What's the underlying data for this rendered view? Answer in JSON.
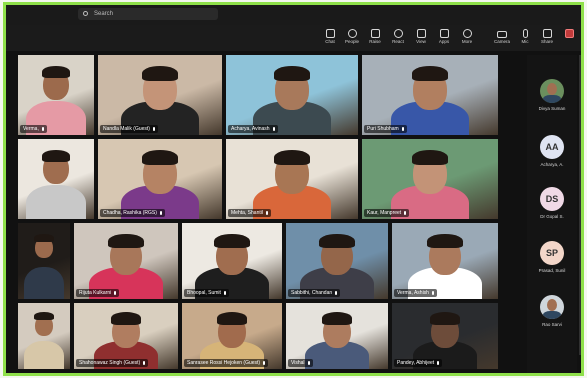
{
  "topbar": {
    "search_placeholder": "Search"
  },
  "toolbar": {
    "items": [
      {
        "label": "Chat",
        "icon": "chat-icon"
      },
      {
        "label": "People",
        "icon": "people-icon"
      },
      {
        "label": "Raise",
        "icon": "raise-hand-icon"
      },
      {
        "label": "React",
        "icon": "react-icon"
      },
      {
        "label": "View",
        "icon": "view-icon"
      },
      {
        "label": "Apps",
        "icon": "apps-icon"
      },
      {
        "label": "More",
        "icon": "more-icon"
      },
      {
        "label": "Camera",
        "icon": "camera-icon"
      },
      {
        "label": "Mic",
        "icon": "mic-icon"
      },
      {
        "label": "Share",
        "icon": "share-icon"
      },
      {
        "label": "",
        "icon": "leave-icon"
      }
    ]
  },
  "grid": {
    "tiles": [
      {
        "name": "Verma,",
        "bg": "#d9d3c8",
        "skin": "#9c6a4c",
        "shirt": "#e59aa5"
      },
      {
        "name": "Nandla Malik (Guest)",
        "bg": "#cbb9a6",
        "skin": "#c49478",
        "shirt": "#232323"
      },
      {
        "name": "Acharya, Avinash",
        "bg": "#8ec3d9",
        "skin": "#a8795b",
        "shirt": "#3c4a50"
      },
      {
        "name": "Puri Shubham",
        "bg": "#a7b0b8",
        "skin": "#b17f60",
        "shirt": "#3857a8"
      },
      {
        "name": "",
        "bg": "#ece7df",
        "skin": "#9f6d4f",
        "shirt": "#c8c8c8"
      },
      {
        "name": "Chadha, Rashika (RGS)",
        "bg": "#d7c7b2",
        "skin": "#b58364",
        "shirt": "#7b3a8a"
      },
      {
        "name": "Mehta, Shantil",
        "bg": "#e8e1d6",
        "skin": "#a87654",
        "shirt": "#d9673a"
      },
      {
        "name": "Kaur, Manpreet",
        "bg": "#6c9a74",
        "skin": "#c39377",
        "shirt": "#d96b84"
      },
      {
        "name": "",
        "bg": "#201c19",
        "skin": "#9b6a4d",
        "shirt": "#2f3a4a"
      },
      {
        "name": "Rijuta Kulkarni",
        "bg": "#cfc6bd",
        "skin": "#a8775a",
        "shirt": "#d7345a"
      },
      {
        "name": "Bhoopal, Sumit",
        "bg": "#ede9e2",
        "skin": "#a06d4f",
        "shirt": "#1e1e1e"
      },
      {
        "name": "Sabbithi, Chandan",
        "bg": "#6f8fa9",
        "skin": "#94664a",
        "shirt": "#3e3e48"
      },
      {
        "name": "Verma, Ashish",
        "bg": "#9aa9b6",
        "skin": "#ab7a5d",
        "shirt": "#ffffff"
      },
      {
        "name": "",
        "bg": "#d4cbbf",
        "skin": "#a16f50",
        "shirt": "#d7c7a8"
      },
      {
        "name": "Shahonawaz Singh (Guest)",
        "bg": "#d9cfbf",
        "skin": "#b07d60",
        "shirt": "#8f2f2f"
      },
      {
        "name": "Sanrasee Rossi Hejoken (Guest)",
        "bg": "#c7aa8b",
        "skin": "#a16b4d",
        "shirt": "#d6b478"
      },
      {
        "name": "Vishal",
        "bg": "#e5e2dc",
        "skin": "#ad7c5f",
        "shirt": "#4a5a7a"
      },
      {
        "name": "Pandey, Abhijeet",
        "bg": "#2a2c2f",
        "skin": "#6d4c3a",
        "shirt": "#1b1b1b"
      }
    ]
  },
  "panel": {
    "people": [
      {
        "initials": "",
        "name": "Divya Suman",
        "color": "#6b8f5e",
        "kind": "photo"
      },
      {
        "initials": "AA",
        "name": "Acharya, A.",
        "color": "#dfe4f2"
      },
      {
        "initials": "DS",
        "name": "Dr Gopal S.",
        "color": "#f0d9e6"
      },
      {
        "initials": "SP",
        "name": "Prasad, Sunil",
        "color": "#f3d6c9"
      },
      {
        "initials": "",
        "name": "Rao Sarvi",
        "color": "#cfd6db",
        "kind": "photo"
      }
    ]
  }
}
